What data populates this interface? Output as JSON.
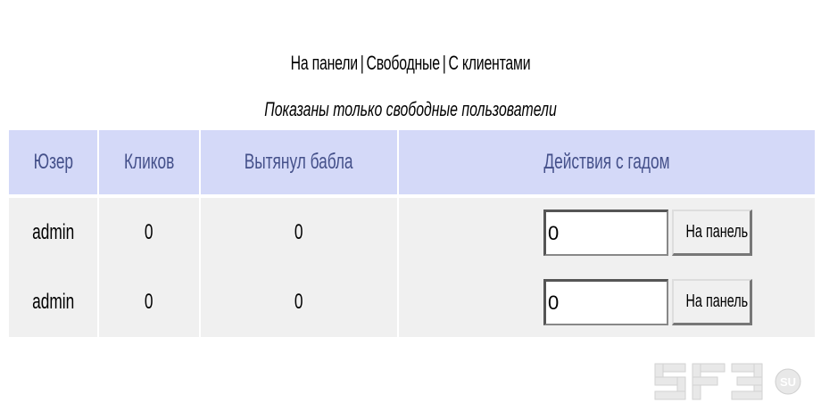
{
  "nav": {
    "link_on_panel": "На панели",
    "link_free": "Свободные",
    "link_with_clients": "С клиентами",
    "separator": "|"
  },
  "subtitle": "Показаны только свободные пользователи",
  "table": {
    "headers": [
      "Юзер",
      "Кликов",
      "Вытянул бабла",
      "Действия с гадом"
    ],
    "rows": [
      {
        "user": "admin",
        "clicks": "0",
        "money": "0",
        "input_value": "0",
        "button_label": "На панель"
      },
      {
        "user": "admin",
        "clicks": "0",
        "money": "0",
        "input_value": "0",
        "button_label": "На панель"
      }
    ]
  },
  "logo": {
    "text": "SFB",
    "suffix": "SU"
  },
  "colors": {
    "header_bg": "#d4d9f8",
    "header_text": "#44508a",
    "row_bg": "#f0f0f0",
    "logo": "#e8e8e8"
  }
}
